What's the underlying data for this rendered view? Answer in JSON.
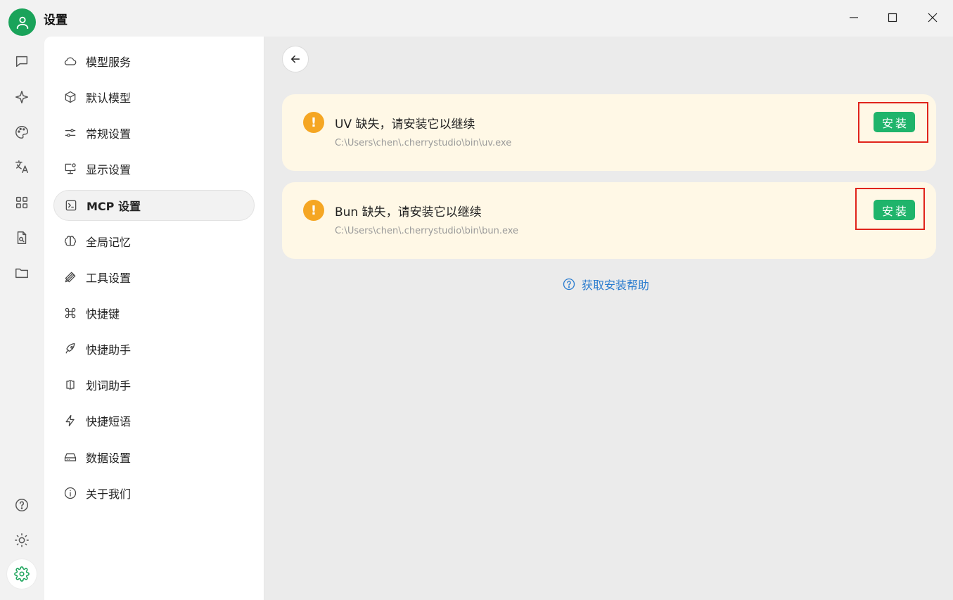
{
  "window": {
    "title": "设置",
    "accent_color": "#1aa35a"
  },
  "rail": {
    "icons": [
      "chat-icon",
      "sparkle-icon",
      "palette-icon",
      "translate-icon",
      "apps-icon",
      "document-search-icon",
      "folder-icon",
      "help-icon",
      "brightness-icon",
      "settings-icon"
    ]
  },
  "nav": {
    "items": [
      {
        "label": "模型服务",
        "icon": "cloud-icon"
      },
      {
        "label": "默认模型",
        "icon": "cube-icon"
      },
      {
        "label": "常规设置",
        "icon": "sliders-icon"
      },
      {
        "label": "显示设置",
        "icon": "monitor-settings-icon"
      },
      {
        "label": "MCP 设置",
        "icon": "terminal-icon",
        "active": true
      },
      {
        "label": "全局记忆",
        "icon": "brain-icon"
      },
      {
        "label": "工具设置",
        "icon": "pencil-ruler-icon"
      },
      {
        "label": "快捷键",
        "icon": "command-icon"
      },
      {
        "label": "快捷助手",
        "icon": "rocket-icon"
      },
      {
        "label": "划词助手",
        "icon": "text-select-icon"
      },
      {
        "label": "快捷短语",
        "icon": "zap-icon"
      },
      {
        "label": "数据设置",
        "icon": "hard-drive-icon"
      },
      {
        "label": "关于我们",
        "icon": "info-icon"
      }
    ]
  },
  "main": {
    "cards": [
      {
        "title": "UV 缺失，请安装它以继续",
        "path": "C:\\Users\\chen\\.cherrystudio\\bin\\uv.exe",
        "button": "安装"
      },
      {
        "title": "Bun 缺失，请安装它以继续",
        "path": "C:\\Users\\chen\\.cherrystudio\\bin\\bun.exe",
        "button": "安装"
      }
    ],
    "help_link": "获取安装帮助",
    "warning_glyph": "!",
    "colors": {
      "warning": "#f5a623",
      "card_bg": "#fff8e6",
      "button": "#1fb46b",
      "link": "#2a7ccf",
      "highlight": "#e0241b"
    }
  }
}
